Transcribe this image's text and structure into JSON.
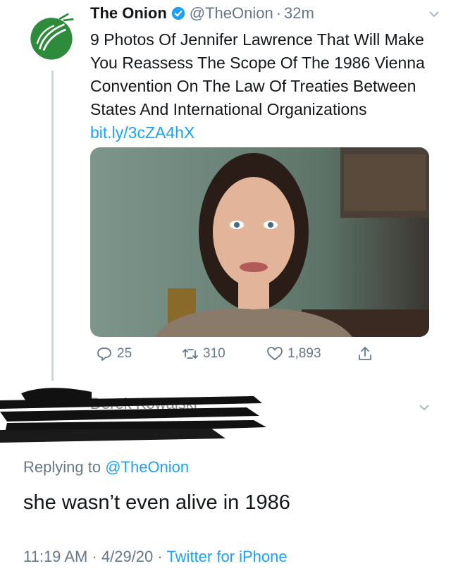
{
  "tweet": {
    "author_name": "The Onion",
    "handle": "@TheOnion",
    "separator": "·",
    "time": "32m",
    "text": "9 Photos Of Jennifer Lawrence That Will Make You Reassess The Scope Of The 1986 Vienna Convention On The Law Of Treaties Between States And International Organizations",
    "link": "bit.ly/3cZA4hX",
    "avatar_icon": "onion-logo-icon",
    "verified_icon": "verified-badge-icon",
    "menu_icon": "chevron-down-icon",
    "actions": {
      "replies": "25",
      "retweets": "310",
      "likes": "1,893"
    }
  },
  "reply": {
    "redacted_name": "Derek Kowalski",
    "replying_prefix": "Replying to",
    "replying_to": "@TheOnion",
    "text": "she wasn’t even alive in 1986",
    "timestamp": "11:19 AM · 4/29/20 ·",
    "source": "Twitter for iPhone",
    "menu_icon": "chevron-down-icon"
  },
  "colors": {
    "link": "#1da1f2",
    "secondary_text": "#657786",
    "onion_green": "#2e8b3b",
    "verified_blue": "#1da1f2",
    "thread_line": "#ccd6dd"
  }
}
